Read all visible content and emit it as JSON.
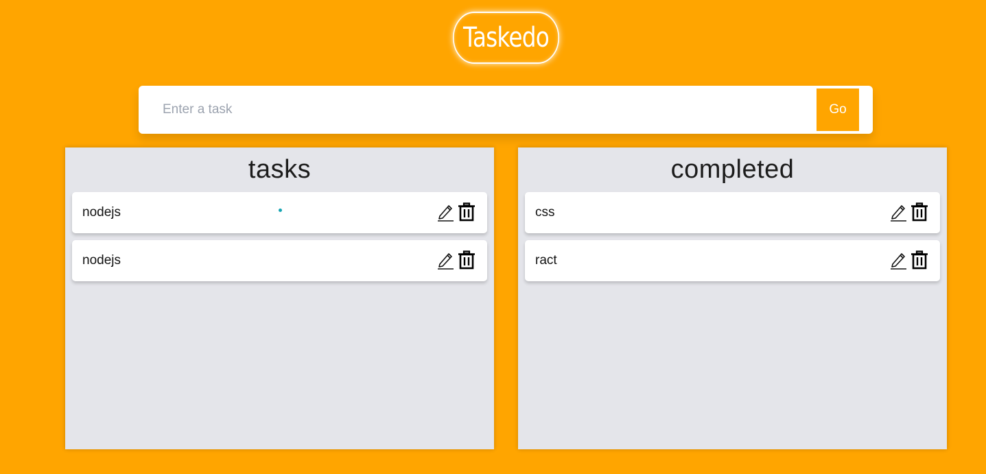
{
  "app": {
    "title": "Taskedo"
  },
  "form": {
    "placeholder": "Enter a task",
    "value": "",
    "submit_label": "Go"
  },
  "columns": [
    {
      "title": "tasks",
      "items": [
        {
          "text": "nodejs"
        },
        {
          "text": "nodejs"
        }
      ]
    },
    {
      "title": "completed",
      "items": [
        {
          "text": "css"
        },
        {
          "text": "ract"
        }
      ]
    }
  ],
  "icons": {
    "edit": "pencil-icon",
    "delete": "trash-icon"
  },
  "colors": {
    "background": "#ffa500",
    "accent": "#ffa500",
    "column_bg": "#e4e5ea",
    "drag_dot": "#17a5b3"
  }
}
